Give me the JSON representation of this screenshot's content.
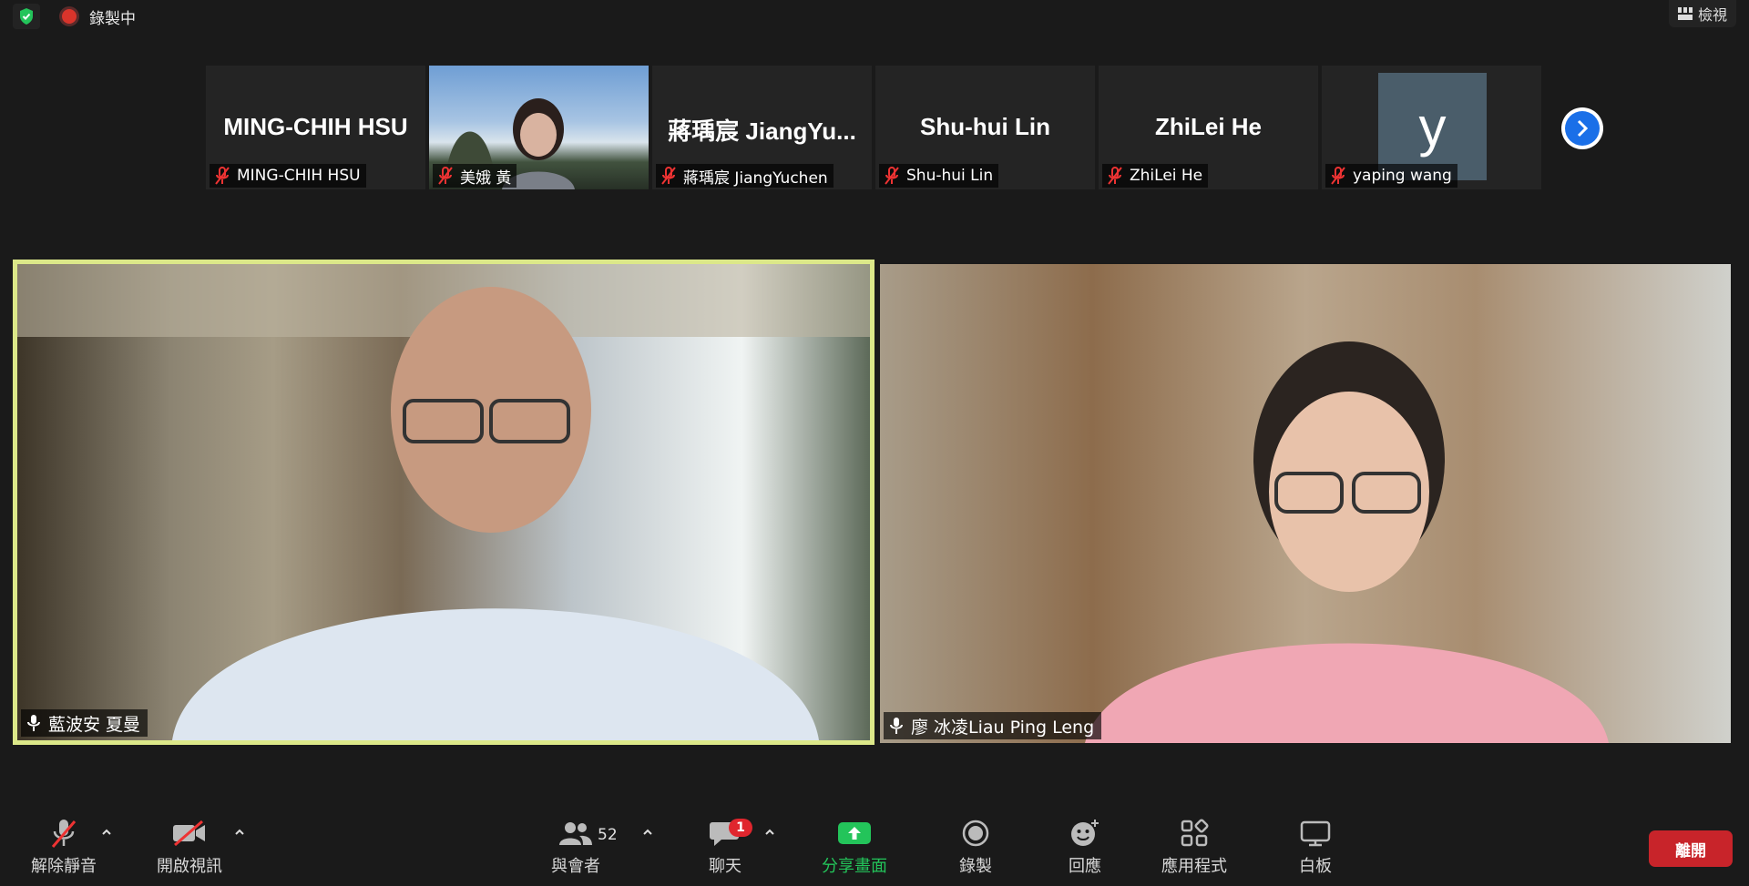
{
  "topbar": {
    "recording_text": "錄製中",
    "view_label": "檢視"
  },
  "strip": [
    {
      "big_name": "MING-CHIH HSU",
      "label": "MING-CHIH HSU",
      "video": false
    },
    {
      "big_name": "",
      "label": "美娥 黃",
      "video": true
    },
    {
      "big_name": "蔣瑀宸 JiangYu...",
      "label": "蔣瑀宸 JiangYuchen",
      "video": false
    },
    {
      "big_name": "Shu-hui Lin",
      "label": "Shu-hui Lin",
      "video": false
    },
    {
      "big_name": "ZhiLei He",
      "label": "ZhiLei He",
      "video": false
    },
    {
      "big_name": "y",
      "label": "yaping wang",
      "video": false
    }
  ],
  "main": {
    "left_name": "藍波安 夏曼",
    "right_name": "廖 冰凌Liau Ping Leng"
  },
  "toolbar": {
    "unmute": "解除靜音",
    "start_video": "開啟視訊",
    "participants": "與會者",
    "participants_count": "52",
    "chat": "聊天",
    "chat_badge": "1",
    "share": "分享畫面",
    "record": "錄製",
    "reactions": "回應",
    "apps": "應用程式",
    "whiteboard": "白板",
    "leave": "離開"
  },
  "colors": {
    "active_speaker_border": "#dce889",
    "share_green": "#23c45a",
    "leave_red": "#c8242a",
    "badge_red": "#e0262e",
    "next_blue": "#1a6fe8"
  }
}
